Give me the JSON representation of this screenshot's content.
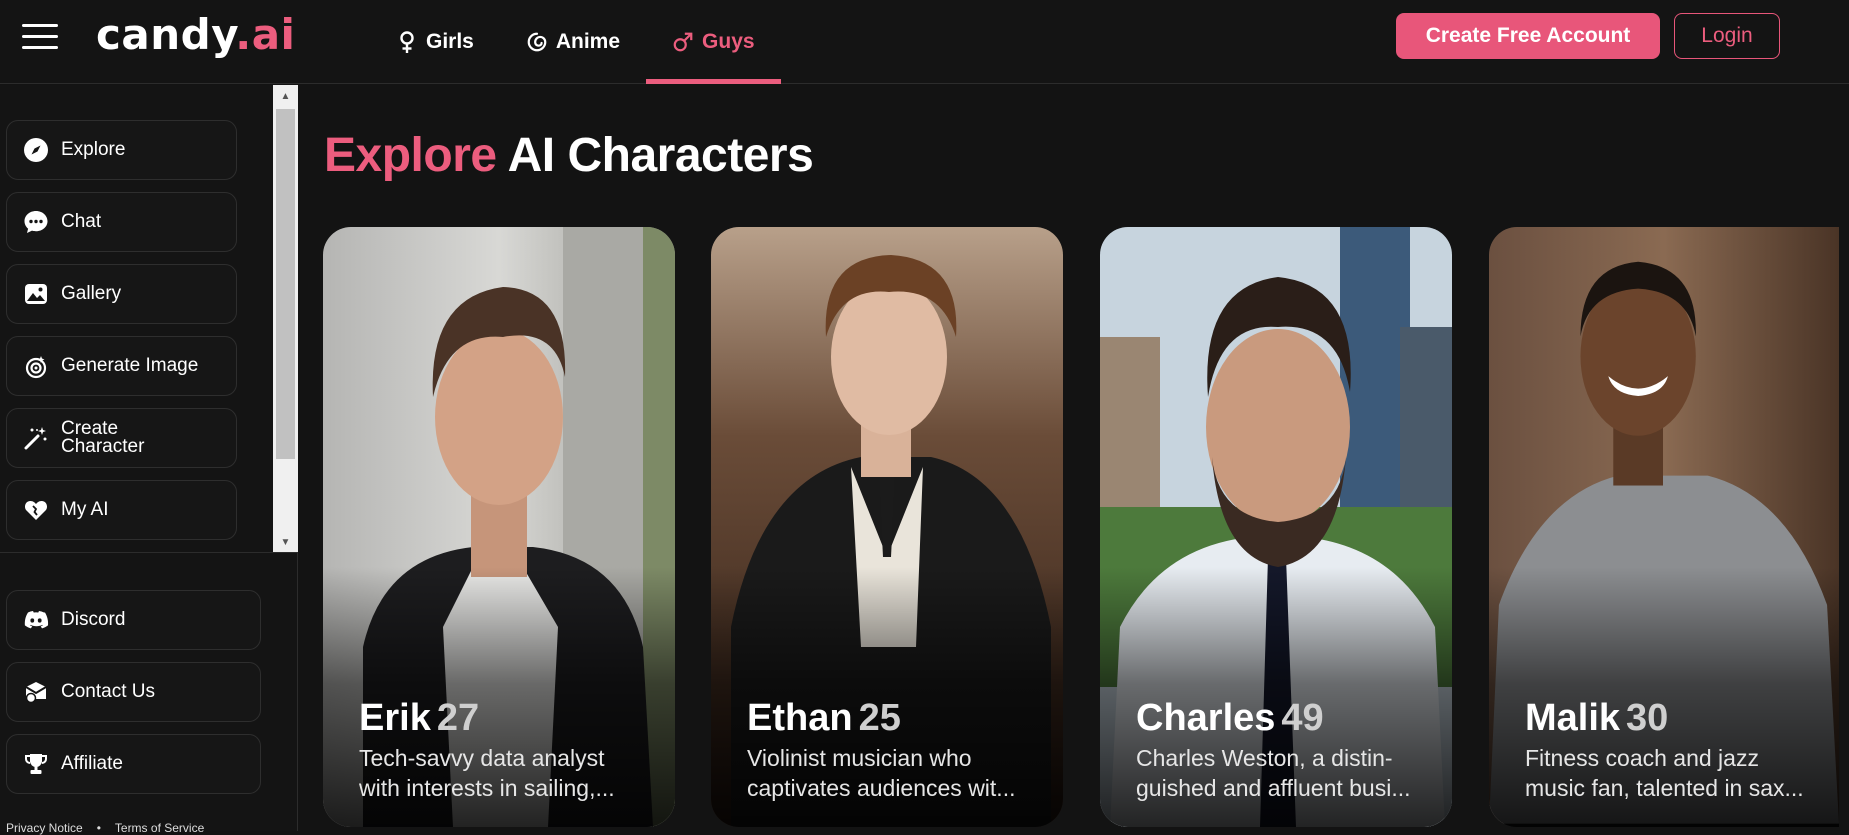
{
  "header": {
    "logo_main": "candy",
    "logo_accent": ".ai",
    "tabs": [
      {
        "label": "Girls",
        "icon": "female-icon",
        "active": false
      },
      {
        "label": "Anime",
        "icon": "anime-swirl-icon",
        "active": false
      },
      {
        "label": "Guys",
        "icon": "male-icon",
        "active": true
      }
    ],
    "create_account": "Create Free Account",
    "login": "Login"
  },
  "sidebar": {
    "items": [
      {
        "label": "Explore",
        "icon": "compass-icon"
      },
      {
        "label": "Chat",
        "icon": "chat-bubble-icon"
      },
      {
        "label": "Gallery",
        "icon": "gallery-icon"
      },
      {
        "label": "Generate Image",
        "icon": "generate-image-icon"
      },
      {
        "label_line1": "Create",
        "label_line2": "Character",
        "icon": "magic-wand-icon"
      },
      {
        "label": "My AI",
        "icon": "heart-icon"
      }
    ],
    "bottom_items": [
      {
        "label": "Discord",
        "icon": "discord-icon"
      },
      {
        "label": "Contact Us",
        "icon": "contact-icon"
      },
      {
        "label": "Affiliate",
        "icon": "trophy-icon"
      }
    ],
    "footer": {
      "privacy": "Privacy Notice",
      "separator": "•",
      "terms": "Terms of Service"
    }
  },
  "main": {
    "title_accent": "Explore",
    "title_rest": "AI Characters",
    "characters": [
      {
        "name": "Erik",
        "age": "27",
        "desc_line1": "Tech-savvy data analyst",
        "desc_line2": "with interests in sailing,..."
      },
      {
        "name": "Ethan",
        "age": "25",
        "desc_line1": "Violinist musician who",
        "desc_line2": "captivates audiences wit..."
      },
      {
        "name": "Charles",
        "age": "49",
        "desc_line1": "Charles Weston, a distin-",
        "desc_line2": "guished and affluent busi..."
      },
      {
        "name": "Malik",
        "age": "30",
        "desc_line1": "Fitness coach and jazz",
        "desc_line2": "music fan, talented in sax..."
      }
    ]
  },
  "colors": {
    "accent": "#ec5d7e",
    "background": "#131313"
  }
}
